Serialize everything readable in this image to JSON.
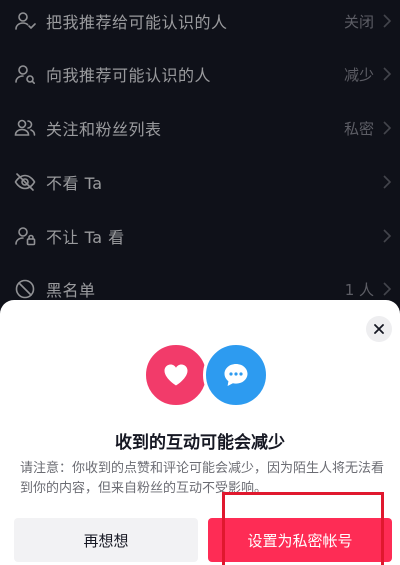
{
  "settings": {
    "items": [
      {
        "icon": "user-recommend-icon",
        "label": "把我推荐给可能认识的人",
        "value": "关闭"
      },
      {
        "icon": "user-discover-icon",
        "label": "向我推荐可能认识的人",
        "value": "减少"
      },
      {
        "icon": "users-icon",
        "label": "关注和粉丝列表",
        "value": "私密"
      },
      {
        "icon": "eye-off-icon",
        "label": "不看 Ta",
        "value": ""
      },
      {
        "icon": "user-lock-icon",
        "label": "不让 Ta 看",
        "value": ""
      },
      {
        "icon": "ban-icon",
        "label": "黑名单",
        "value": "1 人"
      }
    ]
  },
  "dialog": {
    "title": "收到的互动可能会减少",
    "description": "请注意：你收到的点赞和评论可能会减少，因为陌生人将无法看到你的内容，但来自粉丝的互动不受影响。",
    "cancel_label": "再想想",
    "confirm_label": "设置为私密帐号",
    "close_icon": "close-icon",
    "heart_icon": "heart-icon",
    "chat_icon": "chat-bubble-icon"
  },
  "colors": {
    "background": "#161823",
    "accent": "#fe2c55",
    "heart_bubble": "#f23b6a",
    "chat_bubble": "#2d9bf0",
    "highlight": "#e0182e"
  }
}
